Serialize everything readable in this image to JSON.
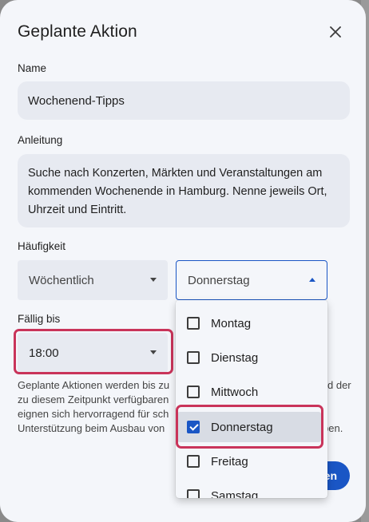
{
  "dialog": {
    "title": "Geplante Aktion",
    "close_icon": "close-icon"
  },
  "name_field": {
    "label": "Name",
    "value": "Wochenend-Tipps"
  },
  "prompt_field": {
    "label": "Anleitung",
    "value": "Suche nach Konzerten, Märkten und Veranstaltungen am kommenden Wochenende in Hamburg. Nenne jeweils Ort, Uhrzeit und Eintritt."
  },
  "frequency": {
    "label": "Häufigkeit",
    "value": "Wöchentlich",
    "day_value": "Donnerstag"
  },
  "due": {
    "label": "Fällig bis",
    "value": "18:00"
  },
  "info_text": "Geplante Aktionen werden bis zu\nzu diesem Zeitpunkt verfügbaren\neignen sich hervorragend für sch\nUnterstützung beim Ausbau von",
  "info_tail": {
    "line1": "d der",
    "line4": "ben."
  },
  "primary_button": {
    "label": "en"
  },
  "day_options": [
    {
      "label": "Montag",
      "checked": false
    },
    {
      "label": "Dienstag",
      "checked": false
    },
    {
      "label": "Mittwoch",
      "checked": false
    },
    {
      "label": "Donnerstag",
      "checked": true
    },
    {
      "label": "Freitag",
      "checked": false
    },
    {
      "label": "Samstag",
      "checked": false
    }
  ],
  "colors": {
    "accent": "#1a56c5",
    "highlight": "#c9345a",
    "dialog_bg": "#f4f6fa",
    "field_bg": "#e7eaf1"
  }
}
